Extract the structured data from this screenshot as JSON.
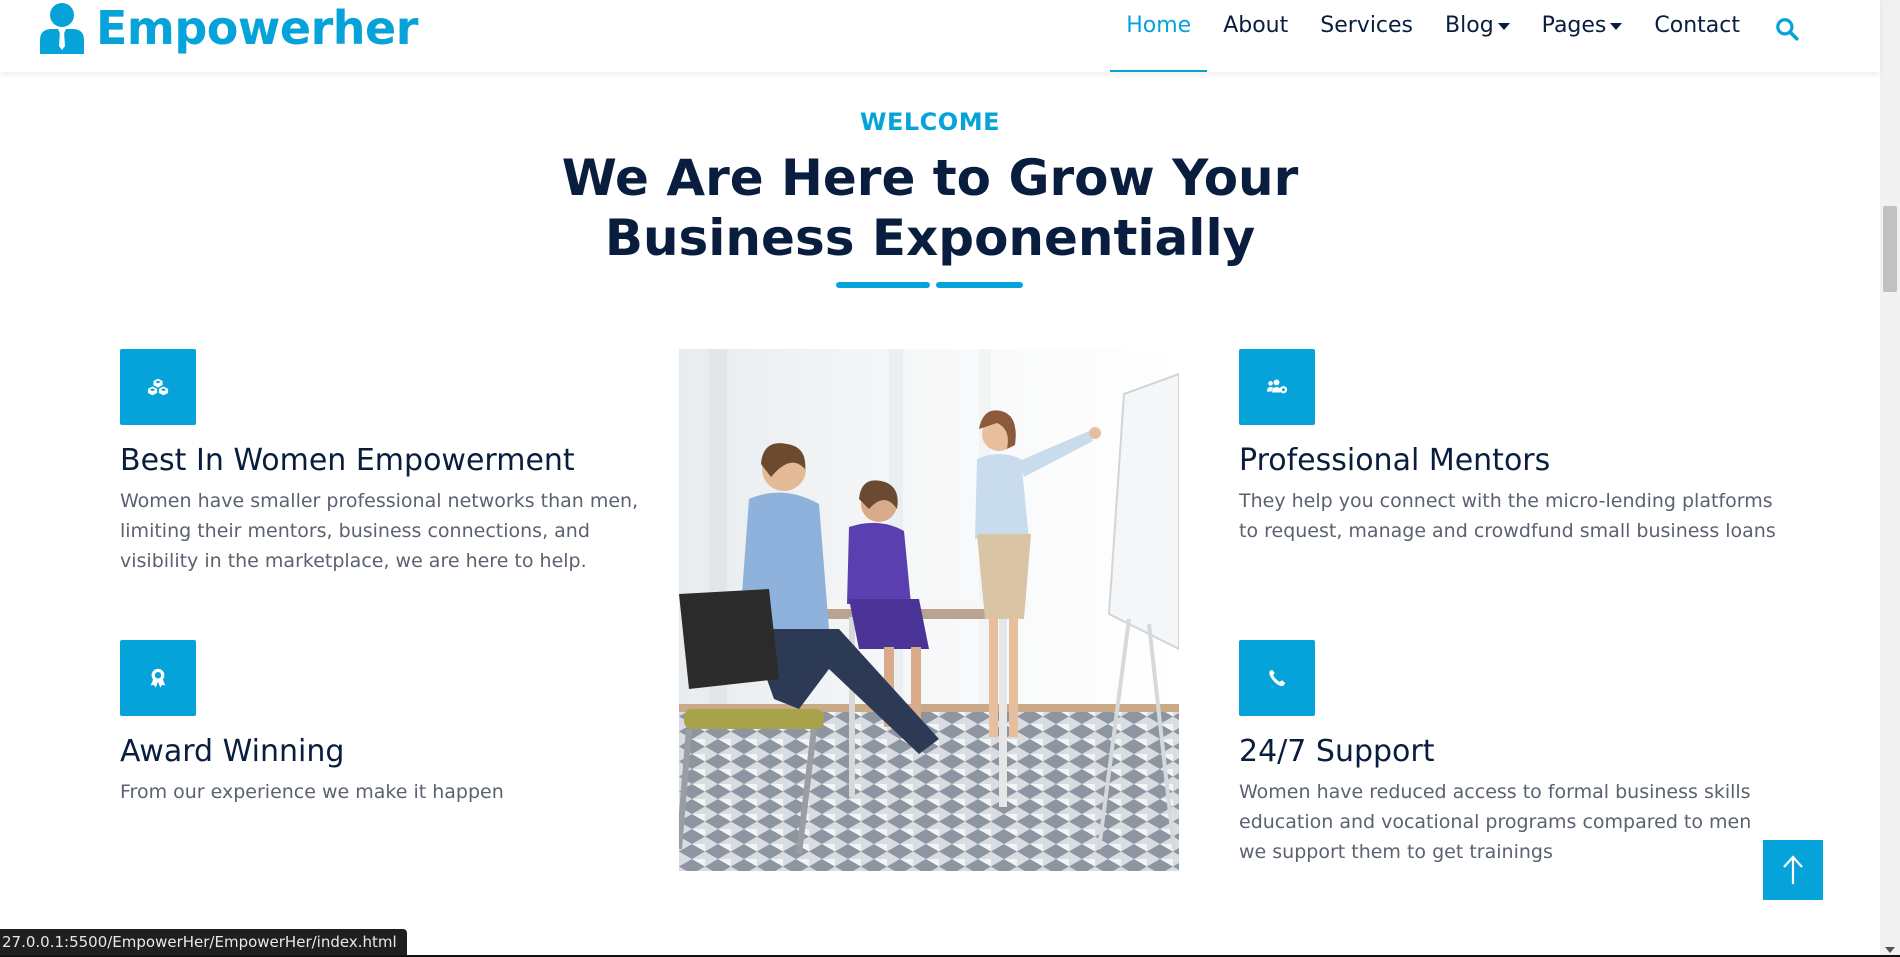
{
  "brand": {
    "name": "Empowerher"
  },
  "nav": {
    "items": [
      {
        "label": "Home",
        "active": true
      },
      {
        "label": "About"
      },
      {
        "label": "Services"
      },
      {
        "label": "Blog",
        "dropdown": true
      },
      {
        "label": "Pages",
        "dropdown": true
      },
      {
        "label": "Contact"
      }
    ],
    "search_icon": "search-icon"
  },
  "section": {
    "eyebrow": "WELCOME",
    "title_line1": "We Are Here to Grow Your",
    "title_line2": "Business Exponentially"
  },
  "features": [
    {
      "icon": "cubes-icon",
      "title": "Best In Women Empowerment",
      "text": "Women have smaller professional networks than men, limiting their mentors, business connections, and visibility in the marketplace, we are here to help."
    },
    {
      "icon": "award-icon",
      "title": "Award Winning",
      "text": "From our experience we make it happen"
    },
    {
      "icon": "users-cog-icon",
      "title": "Professional Mentors",
      "text": "They help you connect with the micro-lending platforms to request, manage and crowdfund small business loans"
    },
    {
      "icon": "phone-icon",
      "title": "24/7 Support",
      "text": "Women have reduced access to formal business skills education and vocational programs compared to men we support them to get trainings"
    }
  ],
  "status_bar": {
    "url": "27.0.0.1:5500/EmpowerHer/EmpowerHer/index.html"
  },
  "colors": {
    "accent": "#06a3da",
    "dark": "#091e3e",
    "muted": "#5a6270"
  }
}
